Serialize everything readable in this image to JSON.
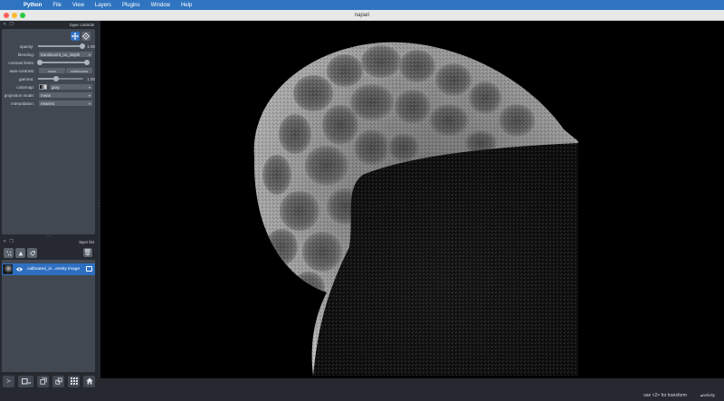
{
  "menubar": {
    "apple_icon": "",
    "app_name": "Python",
    "items": [
      "File",
      "View",
      "Layers",
      "Plugins",
      "Window",
      "Help"
    ]
  },
  "window": {
    "title": "napari"
  },
  "layer_controls": {
    "dock_title": "layer controls",
    "opacity": {
      "label": "opacity:",
      "value": "1.00",
      "level": 1.0
    },
    "blending": {
      "label": "blending:",
      "value": "translucent_no_depth"
    },
    "contrast_limits": {
      "label": "contrast limits:",
      "low": 0.0,
      "high": 1.0
    },
    "auto_contrast": {
      "label": "auto-contrast:",
      "once": "once",
      "continuous": "continuous"
    },
    "gamma": {
      "label": "gamma:",
      "value": "1.00",
      "level": 0.38
    },
    "colormap": {
      "label": "colormap:",
      "value": "gray"
    },
    "projection_mode": {
      "label": "projection mode:",
      "value": "mean"
    },
    "interpolation": {
      "label": "interpolation:",
      "value": "nearest"
    }
  },
  "layer_list": {
    "dock_title": "layer list",
    "layers": [
      {
        "name": "calibrated_in...ensity image",
        "visible": true
      }
    ]
  },
  "status": {
    "hint": "use <2> for transform",
    "activity": "activity"
  },
  "colors": {
    "accent": "#2e6fc2",
    "panel": "#414851",
    "background": "#262930",
    "menubar": "#2f74c0"
  }
}
